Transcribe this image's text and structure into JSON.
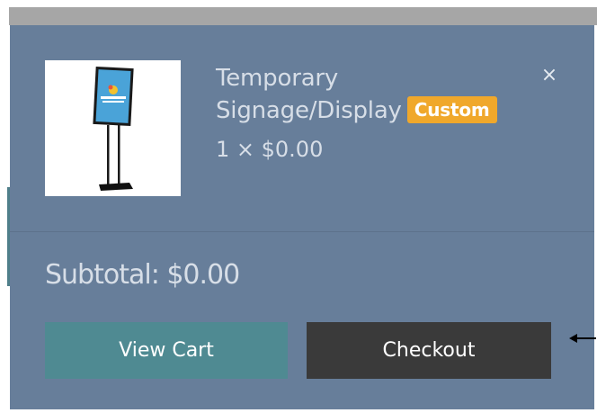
{
  "cart_item": {
    "image_alt": "Temporary Signage/Display stand",
    "title": "Temporary Signage/Display",
    "title_line1": "Temporary",
    "title_line2": "Signage/Display",
    "badge": "Custom",
    "quantity_price": "1 × $0.00",
    "remove_symbol": "×"
  },
  "summary": {
    "subtotal": "Subtotal: $0.00"
  },
  "actions": {
    "view_cart_label": "View Cart",
    "checkout_label": "Checkout"
  },
  "colors": {
    "panel_bg": "#677e9a",
    "view_cart_bg": "#4f8a92",
    "checkout_bg": "#3a3a3a",
    "badge_bg": "#f0a82b",
    "text_light": "#d7dee7"
  }
}
